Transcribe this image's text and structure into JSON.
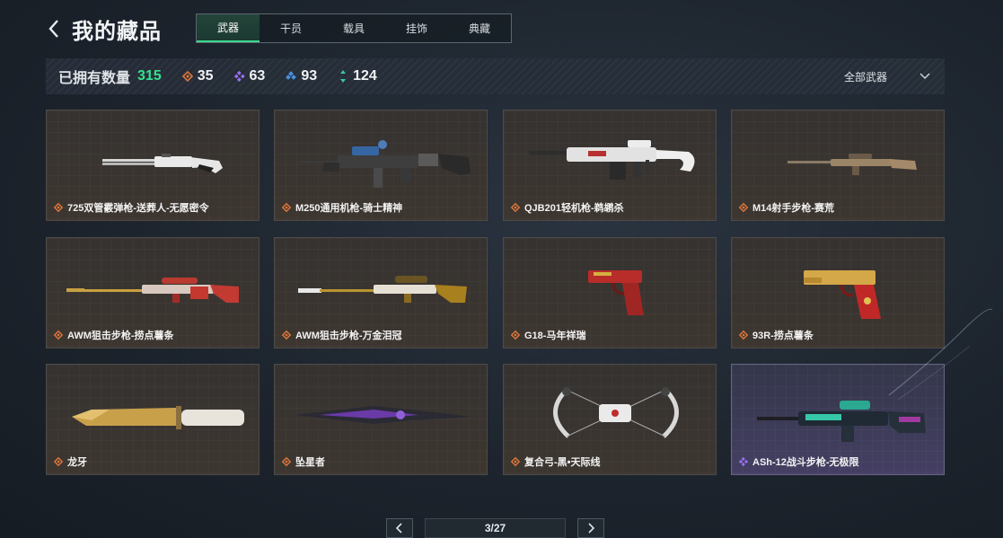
{
  "header": {
    "title": "我的藏品",
    "back_icon": "chevron-left-icon"
  },
  "tabs": [
    {
      "label": "武器",
      "active": true
    },
    {
      "label": "干员",
      "active": false
    },
    {
      "label": "载具",
      "active": false
    },
    {
      "label": "挂饰",
      "active": false
    },
    {
      "label": "典藏",
      "active": false
    }
  ],
  "stats": {
    "owned_label": "已拥有数量",
    "owned_count": "315",
    "rarities": [
      {
        "icon": "orange-diamond-icon",
        "color": "#e0773a",
        "count": "35"
      },
      {
        "icon": "purple-diamond-icon",
        "color": "#9b6ff2",
        "count": "63"
      },
      {
        "icon": "blue-diamond-icon",
        "color": "#4a8fe0",
        "count": "93"
      },
      {
        "icon": "green-arrows-icon",
        "color": "#36c9a0",
        "count": "124"
      }
    ],
    "filter": {
      "label": "全部武器",
      "icon": "chevron-down-icon"
    }
  },
  "items": [
    {
      "name": "725双管霰弹枪-送葬人-无愿密令",
      "rarity": "orange",
      "icon": "shotgun-icon"
    },
    {
      "name": "M250通用机枪-骑士精神",
      "rarity": "orange",
      "icon": "machine-gun-icon"
    },
    {
      "name": "QJB201轻机枪-鹈鹕杀",
      "rarity": "orange",
      "icon": "light-machine-gun-icon"
    },
    {
      "name": "M14射手步枪-赛荒",
      "rarity": "orange",
      "icon": "marksman-rifle-icon"
    },
    {
      "name": "AWM狙击步枪-捞点薯条",
      "rarity": "orange",
      "icon": "sniper-rifle-icon"
    },
    {
      "name": "AWM狙击步枪-万金泪冠",
      "rarity": "orange",
      "icon": "sniper-rifle-icon"
    },
    {
      "name": "G18-马年祥瑞",
      "rarity": "orange",
      "icon": "pistol-icon"
    },
    {
      "name": "93R-捞点薯条",
      "rarity": "orange",
      "icon": "pistol-icon"
    },
    {
      "name": "龙牙",
      "rarity": "orange",
      "icon": "knife-icon"
    },
    {
      "name": "坠星者",
      "rarity": "orange",
      "icon": "blade-icon"
    },
    {
      "name": "复合弓-黑•天际线",
      "rarity": "orange",
      "icon": "compound-bow-icon"
    },
    {
      "name": "ASh-12战斗步枪-无极限",
      "rarity": "purple",
      "icon": "battle-rifle-icon"
    }
  ],
  "pager": {
    "page": "3/27",
    "prev_icon": "chevron-left-icon",
    "next_icon": "chevron-right-icon"
  }
}
